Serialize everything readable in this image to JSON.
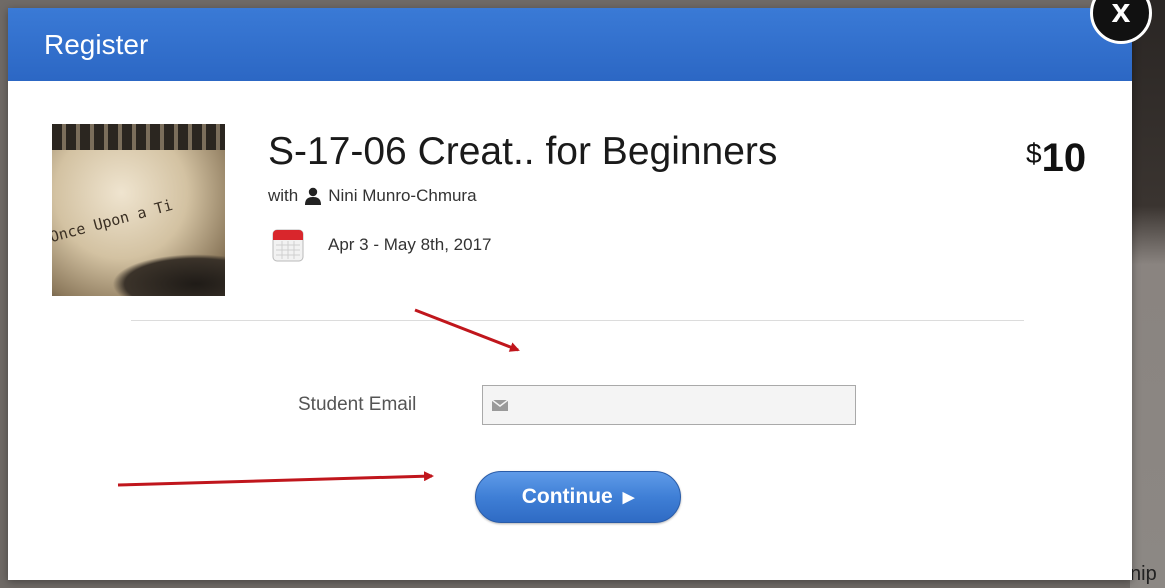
{
  "dialog": {
    "title": "Register",
    "close_label": "x"
  },
  "course": {
    "image_text": "Once Upon a Ti",
    "title": "S-17-06 Creat.. for Beginners",
    "with_label": "with",
    "instructor": "Nini Munro-Chmura",
    "dates": "Apr 3 - May 8th, 2017",
    "price_currency": "$",
    "price_amount": "10"
  },
  "form": {
    "email_label": "Student Email",
    "email_value": "",
    "continue_label": "Continue"
  },
  "background": {
    "visible_text": "nip"
  },
  "colors": {
    "header": "#2c67c4",
    "button": "#3f7fd6",
    "arrow": "#c0161c"
  },
  "icons": {
    "close": "close-icon",
    "person": "person-icon",
    "calendar": "calendar-icon",
    "mail": "mail-icon",
    "continue_arrow": "play-icon"
  }
}
